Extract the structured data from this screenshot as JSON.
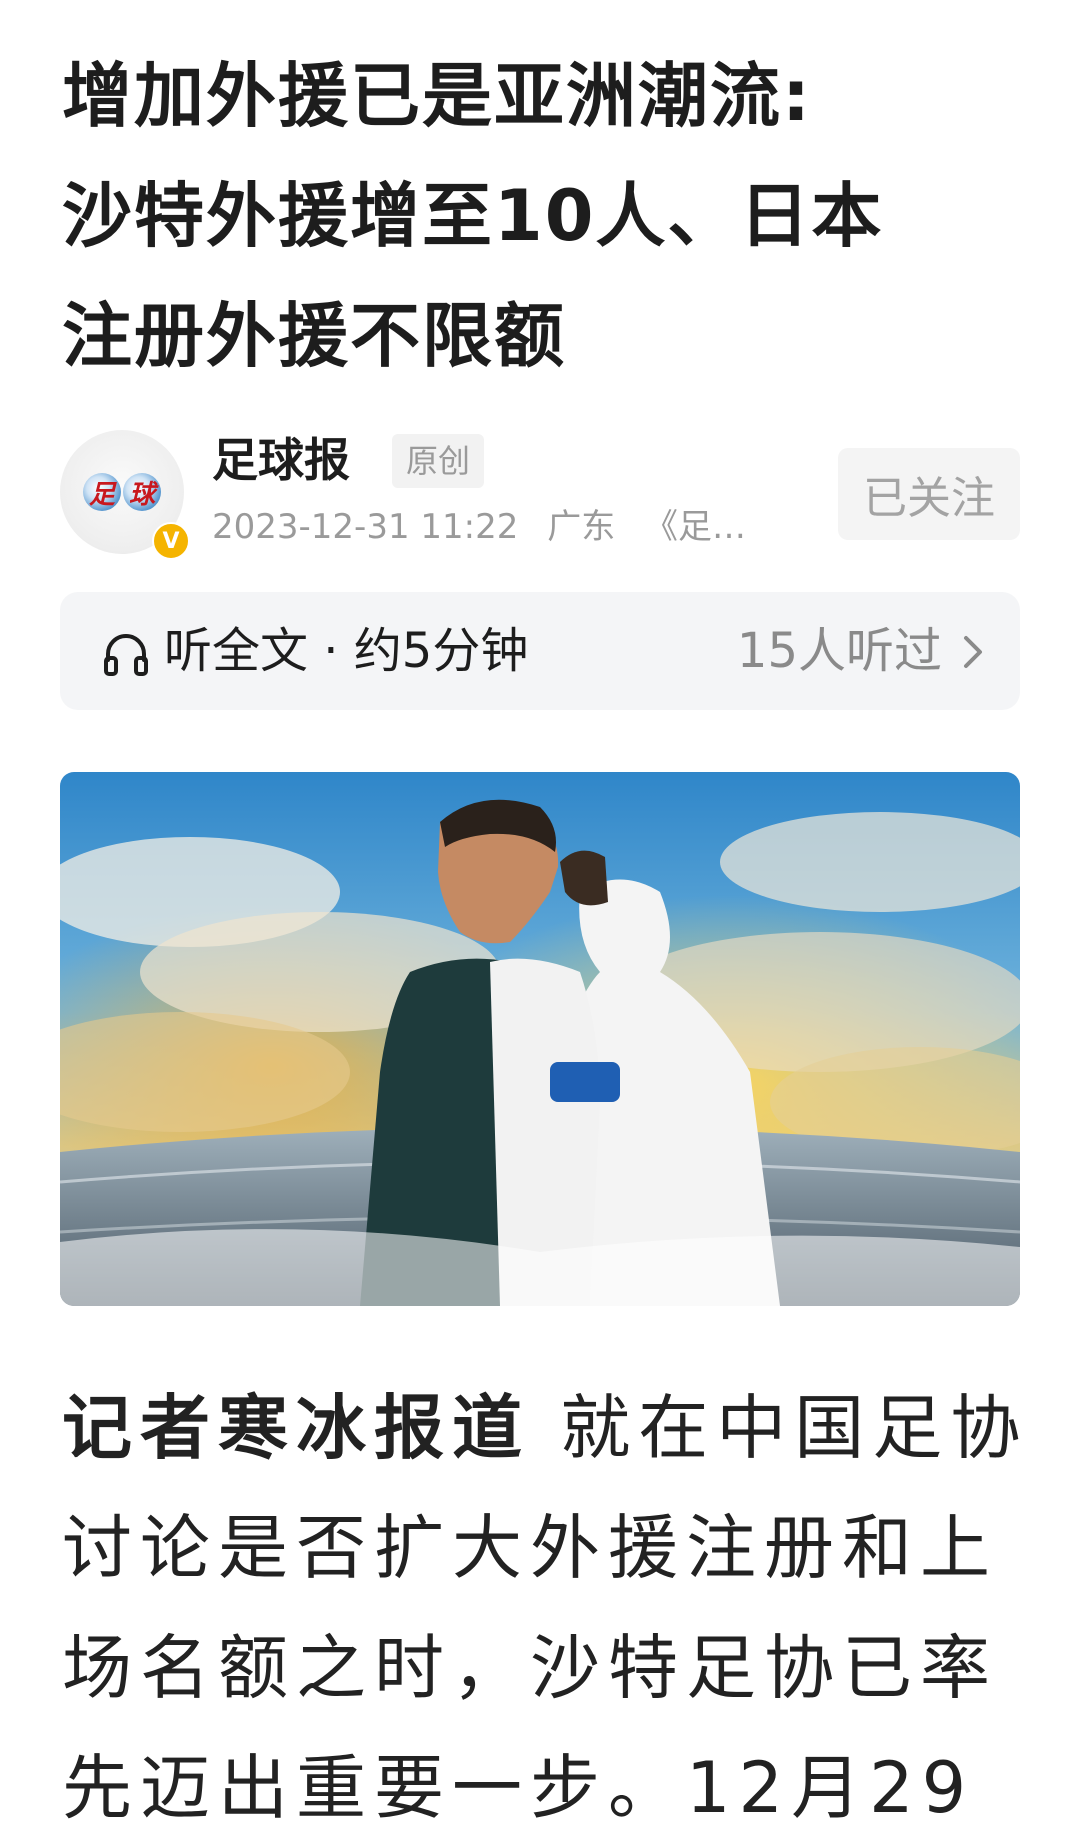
{
  "article": {
    "title_lines": [
      "增加外援已是亚洲潮流:",
      "沙特外援增至10人、日本",
      "注册外援不限额"
    ],
    "author": {
      "name": "足球报",
      "tag": "原创",
      "avatar_text": "足球",
      "verified_badge": "V",
      "datetime": "2023-12-31  11:22",
      "location": "广东",
      "source": "《足…"
    },
    "follow_button": "已关注",
    "listen": {
      "label": "听全文 · 约5分钟",
      "count": "15人听过"
    },
    "body": {
      "lead": "记者寒冰报道",
      "line1_rest": " 就在中国足协",
      "line2": "讨论是否扩大外援注册和上",
      "line3": "场名额之时，沙特足协已率",
      "line4": "先迈出重要一步。12月29"
    }
  },
  "icons": {
    "listen": "headphone-icon",
    "more": "chevron-right-icon",
    "verified": "verified-badge-icon"
  },
  "colors": {
    "text": "#1d1d1d",
    "muted": "#9a9a9a",
    "bar_bg": "#f4f5f7",
    "badge": "#f5b400"
  }
}
